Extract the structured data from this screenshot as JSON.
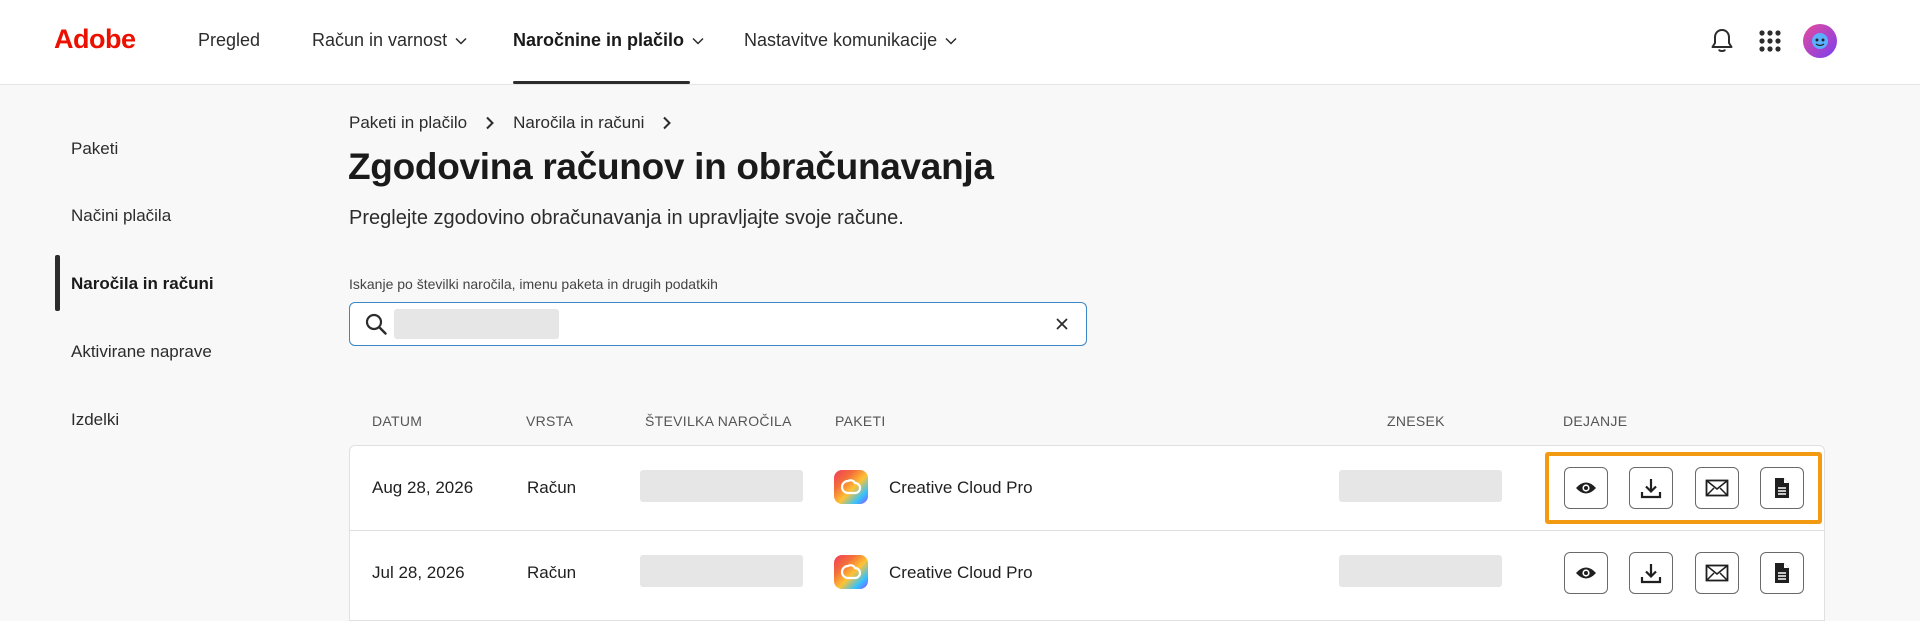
{
  "app": {
    "logo": "Adobe"
  },
  "topnav": {
    "items": [
      {
        "label": "Pregled",
        "dropdown": false,
        "active": false
      },
      {
        "label": "Račun in varnost",
        "dropdown": true,
        "active": false
      },
      {
        "label": "Naročnine in plačilo",
        "dropdown": true,
        "active": true
      },
      {
        "label": "Nastavitve komunikacije",
        "dropdown": true,
        "active": false
      }
    ],
    "icons": [
      "bell-icon",
      "apps-grid-icon",
      "avatar"
    ]
  },
  "sidebar": {
    "items": [
      {
        "label": "Paketi",
        "active": false
      },
      {
        "label": "Načini plačila",
        "active": false
      },
      {
        "label": "Naročila in računi",
        "active": true
      },
      {
        "label": "Aktivirane naprave",
        "active": false
      },
      {
        "label": "Izdelki",
        "active": false
      }
    ]
  },
  "breadcrumb": [
    "Paketi in plačilo",
    "Naročila in računi"
  ],
  "page": {
    "title": "Zgodovina računov in obračunavanja",
    "subtitle": "Preglejte zgodovino obračunavanja in upravljajte svoje račune."
  },
  "search": {
    "label": "Iskanje po številki naročila, imenu paketa in drugih podatkih",
    "clear": "×"
  },
  "table": {
    "headers": {
      "date": "DATUM",
      "type": "VRSTA",
      "order": "ŠTEVILKA NAROČILA",
      "plans": "PAKETI",
      "amount": "ZNESEK",
      "actions": "DEJANJE"
    },
    "rows": [
      {
        "date": "Aug 28, 2026",
        "type": "Račun",
        "plan": "Creative Cloud Pro"
      },
      {
        "date": "Jul 28, 2026",
        "type": "Račun",
        "plan": "Creative Cloud Pro"
      }
    ],
    "actions": [
      "view-icon",
      "download-icon",
      "email-icon",
      "document-icon"
    ]
  },
  "colors": {
    "brand": "#eb1000",
    "highlight": "#f39a13",
    "search_border": "#3b86c6"
  }
}
